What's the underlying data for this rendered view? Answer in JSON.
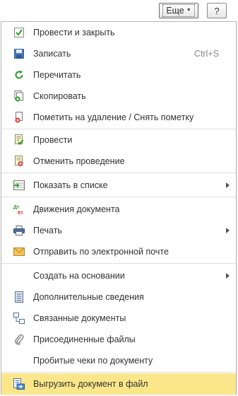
{
  "toolbar": {
    "more_label": "Еще",
    "help_label": "?"
  },
  "menu": {
    "items": [
      {
        "label": "Провести и закрыть",
        "icon": "post-and-close-icon"
      },
      {
        "label": "Записать",
        "shortcut": "Ctrl+S",
        "icon": "save-disk-icon"
      },
      {
        "label": "Перечитать",
        "icon": "reload-icon"
      },
      {
        "label": "Скопировать",
        "icon": "copy-icon"
      },
      {
        "label": "Пометить на удаление / Снять пометку",
        "icon": "mark-delete-icon"
      },
      {
        "label": "Провести",
        "icon": "post-document-icon"
      },
      {
        "label": "Отменить проведение",
        "icon": "cancel-posting-icon"
      },
      {
        "label": "Показать в списке",
        "icon": "show-in-list-icon",
        "submenu": true
      },
      {
        "label": "Движения документа",
        "icon": "debit-credit-icon"
      },
      {
        "label": "Печать",
        "icon": "printer-icon",
        "submenu": true
      },
      {
        "label": "Отправить по электронной почте",
        "icon": "envelope-icon"
      },
      {
        "label": "Создать на основании",
        "submenu": true
      },
      {
        "label": "Дополнительные сведения",
        "icon": "additional-info-icon"
      },
      {
        "label": "Связанные документы",
        "icon": "related-documents-icon"
      },
      {
        "label": "Присоединенные файлы",
        "icon": "paperclip-icon"
      },
      {
        "label": "Пробитые чеки по документу"
      },
      {
        "label": "Выгрузить документ в файл",
        "icon": "export-file-icon",
        "selected": true
      }
    ]
  },
  "colors": {
    "selected_bg": "#fbe68a",
    "separator": "#dedede",
    "border": "#b5b5b5"
  }
}
